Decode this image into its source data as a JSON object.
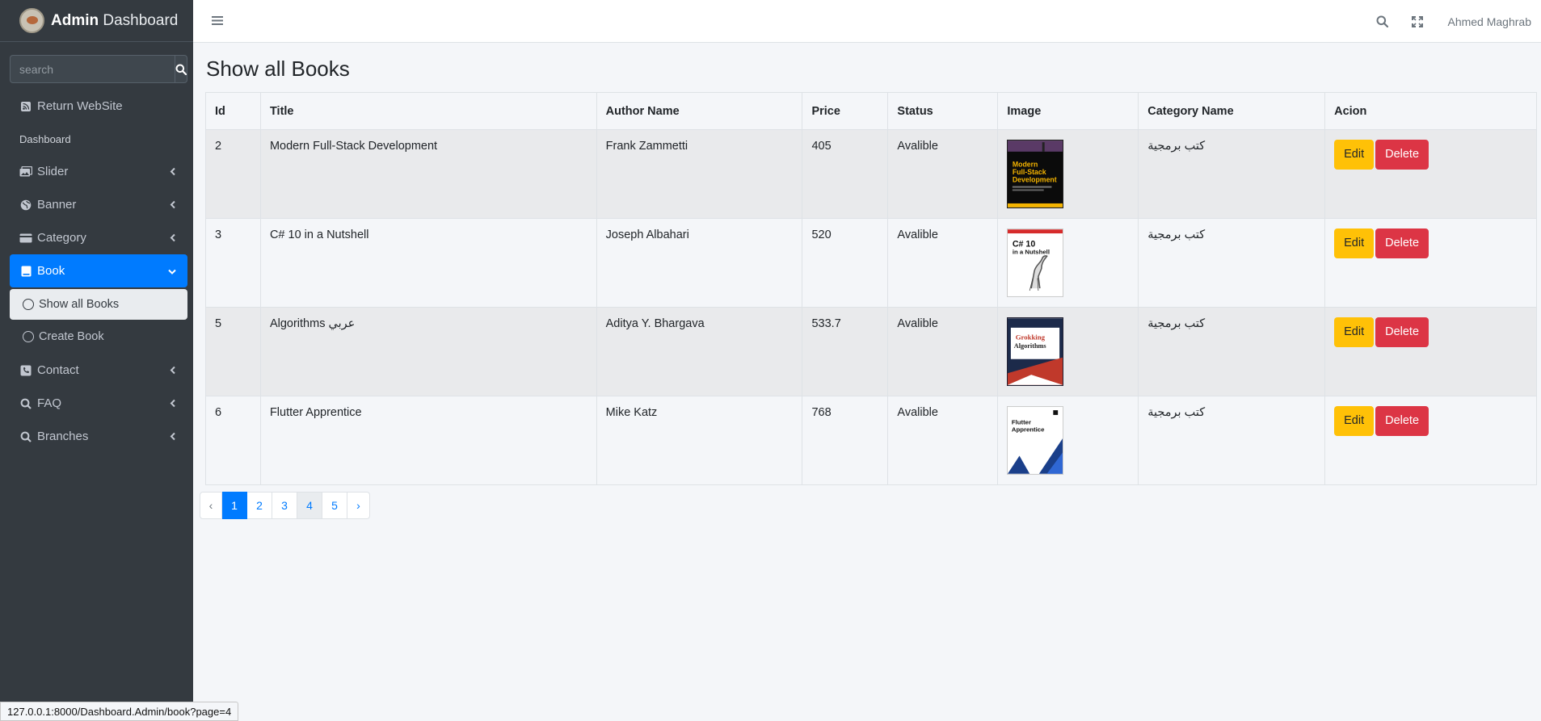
{
  "brand": {
    "bold": "Admin",
    "rest": " Dashboard"
  },
  "search": {
    "placeholder": "search"
  },
  "sidebar": {
    "return_label": "Return WebSite",
    "header": "Dashboard",
    "items": [
      {
        "label": "Slider",
        "icon": "images-icon"
      },
      {
        "label": "Banner",
        "icon": "globe-icon"
      },
      {
        "label": "Category",
        "icon": "card-icon"
      },
      {
        "label": "Book",
        "icon": "book-icon"
      },
      {
        "label": "Contact",
        "icon": "phone-icon"
      },
      {
        "label": "FAQ",
        "icon": "search-q-icon"
      },
      {
        "label": "Branches",
        "icon": "search-q-icon"
      }
    ],
    "sub_items": [
      "Show all Books",
      "Create Book"
    ]
  },
  "navbar": {
    "user": "Ahmed Maghrab"
  },
  "page": {
    "title": "Show all Books"
  },
  "table": {
    "headers": [
      "Id",
      "Title",
      "Author Name",
      "Price",
      "Status",
      "Image",
      "Category Name",
      "Acion"
    ],
    "rows": [
      {
        "id": "2",
        "title": "Modern Full-Stack Development",
        "author": "Frank Zammetti",
        "price": "405",
        "status": "Avalible",
        "category": "كتب برمجية",
        "cover": "Modern Full-Stack Development"
      },
      {
        "id": "3",
        "title": "C# 10 in a Nutshell",
        "author": "Joseph Albahari",
        "price": "520",
        "status": "Avalible",
        "category": "كتب برمجية",
        "cover": "C# 10 in a Nutshell"
      },
      {
        "id": "5",
        "title": "Algorithms عربي",
        "author": "Aditya Y. Bhargava",
        "price": "533.7",
        "status": "Avalible",
        "category": "كتب برمجية",
        "cover": "Grokking Algorithms"
      },
      {
        "id": "6",
        "title": "Flutter Apprentice",
        "author": "Mike Katz",
        "price": "768",
        "status": "Avalible",
        "category": "كتب برمجية",
        "cover": "Flutter Apprentice"
      }
    ],
    "edit_label": "Edit",
    "delete_label": "Delete"
  },
  "pagination": {
    "prev": "‹",
    "pages": [
      "1",
      "2",
      "3",
      "4",
      "5"
    ],
    "next": "›",
    "current": "1"
  },
  "status_url": "127.0.0.1:8000/Dashboard.Admin/book?page=4"
}
